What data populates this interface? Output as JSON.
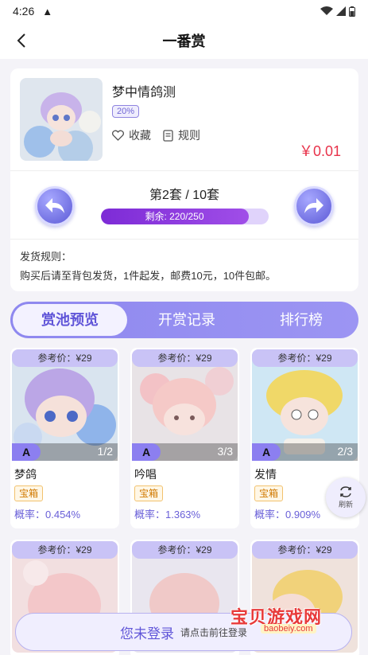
{
  "status_bar": {
    "time": "4:26",
    "warn": "▲"
  },
  "header": {
    "title": "一番赏"
  },
  "product": {
    "name": "梦中情鸽测",
    "rate_badge": "20%",
    "favorite_label": "收藏",
    "rules_label": "规则",
    "price": "￥0.01"
  },
  "set_nav": {
    "set_label": "第2套 / 10套",
    "remaining_text": "剩余: 220/250",
    "remaining_fraction": 0.88
  },
  "shipping": {
    "title": "发货规则：",
    "text": "购买后请至背包发货，1件起发，邮费10元，10件包邮。"
  },
  "tabs": [
    {
      "label": "赏池预览",
      "active": true
    },
    {
      "label": "开赏记录",
      "active": false
    },
    {
      "label": "排行榜",
      "active": false
    }
  ],
  "items": [
    {
      "ref": "参考价：¥29",
      "grade": "A",
      "count": "1/2",
      "name": "梦鸽",
      "tag": "宝箱",
      "prob": "概率：0.454%"
    },
    {
      "ref": "参考价：¥29",
      "grade": "A",
      "count": "3/3",
      "name": "吟唱",
      "tag": "宝箱",
      "prob": "概率：1.363%"
    },
    {
      "ref": "参考价：¥29",
      "grade": "A",
      "count": "2/3",
      "name": "发情",
      "tag": "宝箱",
      "prob": "概率：0.909%"
    },
    {
      "ref": "参考价：¥29"
    },
    {
      "ref": "参考价：¥29"
    },
    {
      "ref": "参考价：¥29"
    }
  ],
  "refresh": {
    "label": "刷新"
  },
  "login": {
    "main": "您未登录",
    "sub": "请点击前往登录"
  },
  "watermark": {
    "cn": "宝贝游戏网",
    "url": "baobeiy.com"
  },
  "colors": {
    "accent": "#6055d8",
    "price": "#e8324a",
    "tag": "#d07900"
  }
}
